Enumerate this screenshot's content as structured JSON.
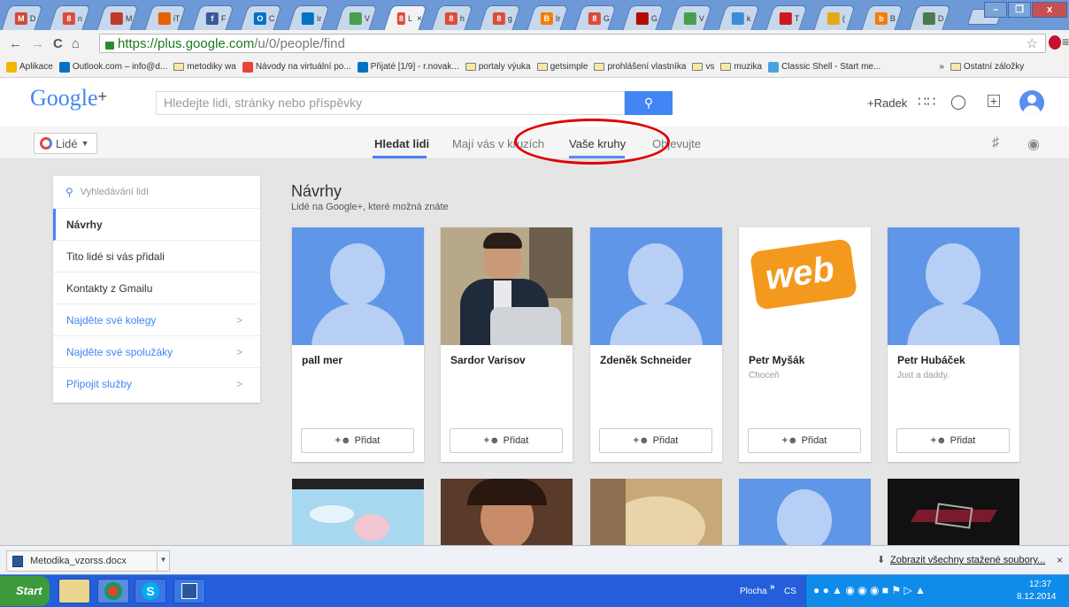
{
  "browser": {
    "tabs": [
      {
        "icon": "gmail",
        "label": "M",
        "short": "D"
      },
      {
        "icon": "google-plus",
        "label": "8",
        "short": "n"
      },
      {
        "icon": "person",
        "label": "",
        "short": "M"
      },
      {
        "icon": "firefox",
        "label": "",
        "short": "iT"
      },
      {
        "icon": "facebook",
        "label": "f",
        "short": "F"
      },
      {
        "icon": "outlook",
        "label": "O",
        "short": "C"
      },
      {
        "icon": "mail",
        "label": "",
        "short": "Ir"
      },
      {
        "icon": "globe",
        "label": "",
        "short": "V"
      },
      {
        "icon": "google-plus",
        "label": "8",
        "short": "L"
      },
      {
        "icon": "google-plus",
        "label": "8",
        "short": "h"
      },
      {
        "icon": "google-plus",
        "label": "8",
        "short": "g"
      },
      {
        "icon": "blogger",
        "label": "B",
        "short": "Ir"
      },
      {
        "icon": "google-plus",
        "label": "8",
        "short": "G"
      },
      {
        "icon": "pdf",
        "label": "",
        "short": "G"
      },
      {
        "icon": "globe",
        "label": "",
        "short": "V"
      },
      {
        "icon": "photo",
        "label": "",
        "short": "k"
      },
      {
        "icon": "youtube",
        "label": "",
        "short": "T"
      },
      {
        "icon": "yellow",
        "label": "",
        "short": "("
      },
      {
        "icon": "b",
        "label": "b",
        "short": "B"
      },
      {
        "icon": "doc",
        "label": "",
        "short": "D"
      }
    ],
    "url_host": "https://plus.google.com",
    "url_path": "/u/0/people/find",
    "bookmarks": [
      {
        "label": "Aplikace",
        "type": "apps"
      },
      {
        "label": "Outlook.com – info@d...",
        "type": "outlook"
      },
      {
        "label": "metodiky wa",
        "type": "folder"
      },
      {
        "label": "Návody na virtuální po...",
        "type": "google"
      },
      {
        "label": "Přijaté [1/9] - r.novak...",
        "type": "mail"
      },
      {
        "label": "portaly výuka",
        "type": "folder"
      },
      {
        "label": "getsimple",
        "type": "folder"
      },
      {
        "label": "prohlášení vlastníka",
        "type": "folder"
      },
      {
        "label": "vs",
        "type": "folder"
      },
      {
        "label": "muzika",
        "type": "folder"
      },
      {
        "label": "Classic Shell - Start me...",
        "type": "shell"
      }
    ],
    "bookmarks_more": "»",
    "other_bookmarks": "Ostatní záložky"
  },
  "gplus": {
    "logo": "Google",
    "logo_plus": "+",
    "search_placeholder": "Hledejte lidi, stránky nebo příspěvky",
    "user_name": "+Radek",
    "section": "Lidé",
    "tabs": [
      "Hledat lidi",
      "Mají vás v kruzích",
      "Vaše kruhy",
      "Objevujte"
    ]
  },
  "sidebar": {
    "search": "Vyhledávání lidí",
    "items": [
      {
        "label": "Návrhy"
      },
      {
        "label": "Tito lidé si vás přidali"
      },
      {
        "label": "Kontakty z Gmailu"
      },
      {
        "label": "Najděte své kolegy"
      },
      {
        "label": "Najděte své spolužáky"
      },
      {
        "label": "Připojit služby"
      }
    ]
  },
  "suggestions": {
    "title": "Návrhy",
    "subtitle": "Lidé na Google+, které možná znáte",
    "add_label": "Přidat",
    "cards": [
      {
        "name": "pall mer",
        "sub": ""
      },
      {
        "name": "Sardor Varisov",
        "sub": ""
      },
      {
        "name": "Zdeněk Schneider",
        "sub": ""
      },
      {
        "name": "Petr Myšák",
        "sub": "Choceň"
      },
      {
        "name": "Petr Hubáček",
        "sub": "Just a daddy."
      }
    ],
    "web_logo": "web"
  },
  "downloads": {
    "file": "Metodika_vzorss.docx",
    "show_all": "Zobrazit všechny stažené soubory...",
    "close": "×"
  },
  "taskbar": {
    "start": "Start",
    "plocha": "Plocha",
    "lang": "CS",
    "time": "12:37",
    "date": "8.12.2014"
  },
  "colors": {
    "accent": "#4285f4",
    "highlight": "#e00000"
  }
}
